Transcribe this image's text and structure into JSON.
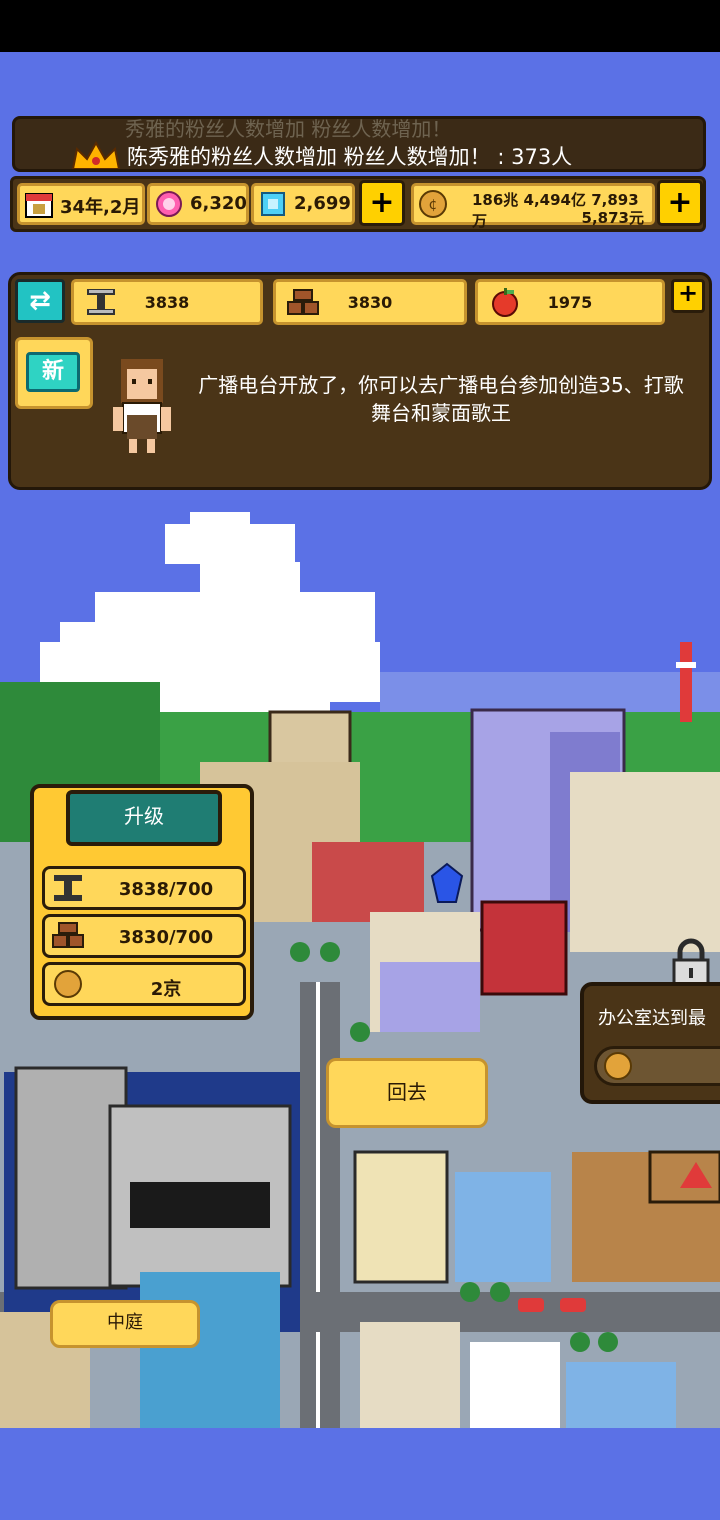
{
  "ticker": {
    "faded_text": "秀雅的粉丝人数增加 粉丝人数增加！",
    "message": "陈秀雅的粉丝人数增加 粉丝人数增加！ : 373人"
  },
  "resources": {
    "date": "34年,2月",
    "gems_pink": "6,320",
    "gems_blue": "2,699",
    "money_line1": "186兆 4,494亿 7,893万",
    "money_line2": "5,873元",
    "plus": "+"
  },
  "materials": {
    "swap_icon": "⇄",
    "iron": "3838",
    "brick": "3830",
    "apple": "1975",
    "plus": "+"
  },
  "notice": {
    "badge": "新",
    "text": "广播电台开放了，你可以去广播电台参加创造35、打歌舞台和蒙面歌王"
  },
  "upgrade": {
    "title": "升级",
    "iron_req": "3838/700",
    "brick_req": "3830/700",
    "coin_req": "2京"
  },
  "buttons": {
    "back": "回去",
    "courtyard": "中庭"
  },
  "office": {
    "text": "办公室达到最"
  },
  "colors": {
    "sky": "#5b71e6",
    "panel": "#4a3417",
    "gold": "#ffd75a",
    "teal": "#1f7d73"
  }
}
